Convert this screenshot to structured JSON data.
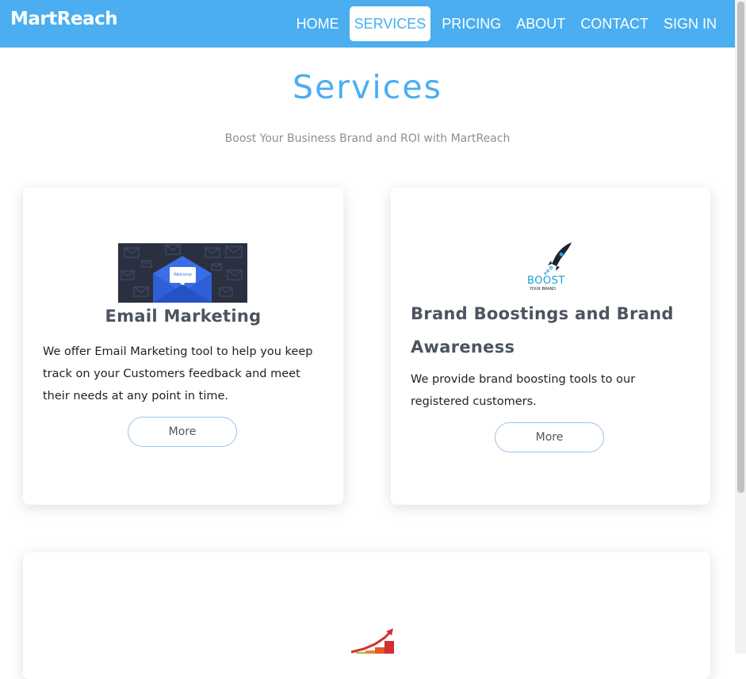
{
  "nav": {
    "brand": "MartReach",
    "links": [
      "HOME",
      "SERVICES",
      "PRICING",
      "ABOUT",
      "CONTACT",
      "SIGN IN"
    ],
    "active": "SERVICES"
  },
  "header": {
    "title": "Services",
    "subtitle": "Boost Your Business Brand and ROI with MartReach"
  },
  "cards": [
    {
      "title": "Email Marketing",
      "description": "We offer Email Marketing tool to help you keep track on your Customers feedback and meet their needs at any point in time.",
      "button": "More",
      "image_label": "Welcome"
    },
    {
      "title": "Brand Boostings and Brand Awareness",
      "description": "We provide brand boosting tools to our registered customers.",
      "button": "More",
      "image_label": "BOOST",
      "image_sublabel": "YOUR BRAND"
    }
  ],
  "colors": {
    "primary": "#4aaef0",
    "heading": "#4d5460",
    "subtitle": "#8a8f96"
  }
}
